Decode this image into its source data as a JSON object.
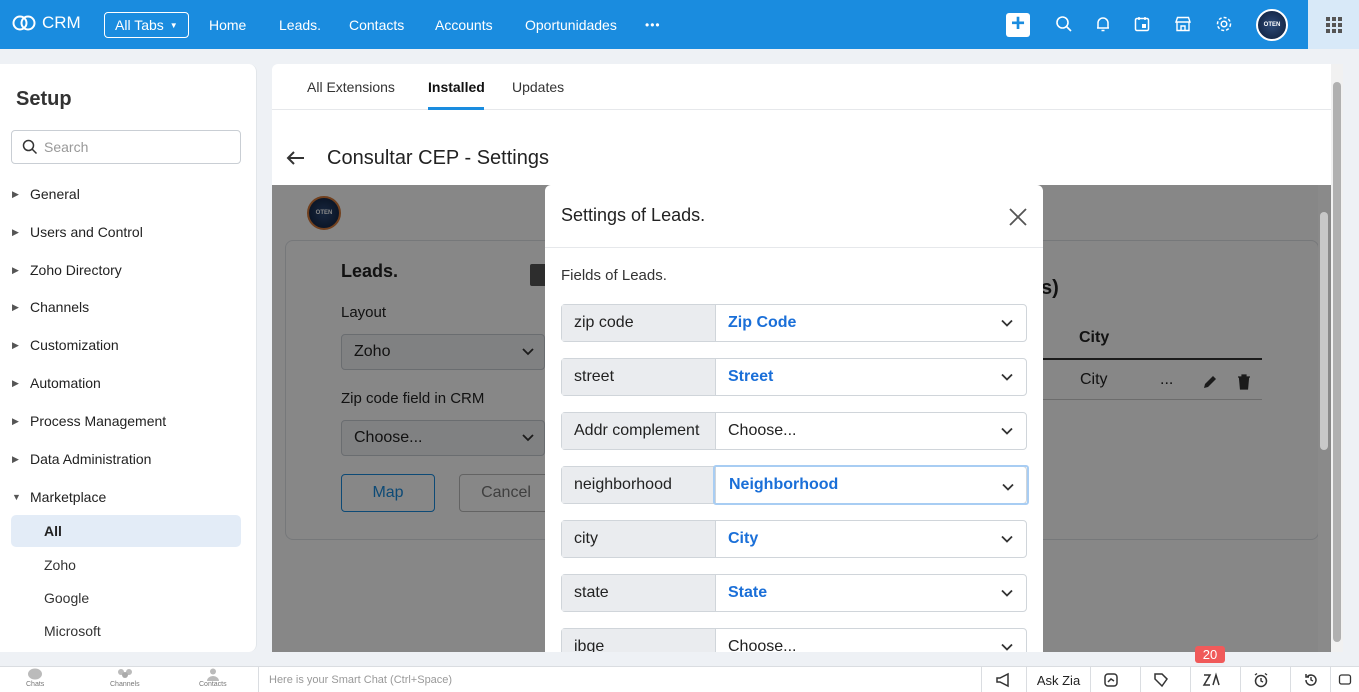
{
  "topbar": {
    "app_name": "CRM",
    "all_tabs": "All Tabs",
    "nav": [
      "Home",
      "Leads.",
      "Contacts",
      "Accounts",
      "Oportunidades"
    ],
    "more": "•••",
    "avatar_text": "OTEN"
  },
  "sidebar": {
    "title": "Setup",
    "search_placeholder": "Search",
    "items": [
      "General",
      "Users and Control",
      "Zoho Directory",
      "Channels",
      "Customization",
      "Automation",
      "Process Management",
      "Data Administration",
      "Marketplace"
    ],
    "sub_items": [
      "All",
      "Zoho",
      "Google",
      "Microsoft"
    ]
  },
  "tabs": [
    "All Extensions",
    "Installed",
    "Updates"
  ],
  "page_title": "Consultar CEP - Settings",
  "background": {
    "module": "Leads.",
    "layout_label": "Layout",
    "layout_value": "Zoho",
    "zip_label": "Zip code field in CRM",
    "zip_value": "Choose...",
    "map_button": "Map",
    "cancel_button": "Cancel",
    "table_header": "City",
    "table_cell": "City",
    "more": "...",
    "paren": "s)"
  },
  "modal": {
    "title": "Settings of Leads.",
    "subtitle": "Fields of Leads.",
    "fields": [
      {
        "label": "zip code",
        "value": "Zip Code"
      },
      {
        "label": "street",
        "value": "Street"
      },
      {
        "label": "Addr complement",
        "value": "Choose..."
      },
      {
        "label": "neighborhood",
        "value": "Neighborhood"
      },
      {
        "label": "city",
        "value": "City"
      },
      {
        "label": "state",
        "value": "State"
      },
      {
        "label": "ibge",
        "value": "Choose..."
      }
    ]
  },
  "bottombar": {
    "items": [
      "Chats",
      "Channels",
      "Contacts"
    ],
    "smart_chat": "Here is your Smart Chat (Ctrl+Space)",
    "ask_zia": "Ask Zia",
    "badge": "20"
  },
  "colors": {
    "primary": "#1a8cdf",
    "link": "#1a6fd8",
    "badge": "#f05a5a"
  }
}
